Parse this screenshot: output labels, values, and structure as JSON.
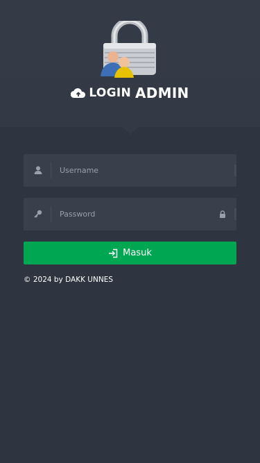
{
  "header": {
    "title_prefix": "LOGIN",
    "title_main": "ADMIN",
    "logo_icon": "padlock-users-icon",
    "cloud_icon": "cloud-upload-icon"
  },
  "form": {
    "username": {
      "placeholder": "Username",
      "value": "",
      "icon": "user-icon"
    },
    "password": {
      "placeholder": "Password",
      "value": "",
      "icon": "key-icon",
      "trailing_icon": "lock-icon"
    },
    "submit": {
      "label": "Masuk",
      "icon": "sign-in-icon"
    }
  },
  "footer": {
    "copyright": "© 2024 by DAKK UNNES"
  },
  "colors": {
    "background": "#2f3540",
    "header": "#343a45",
    "input": "#3a404b",
    "button": "#00a651"
  }
}
